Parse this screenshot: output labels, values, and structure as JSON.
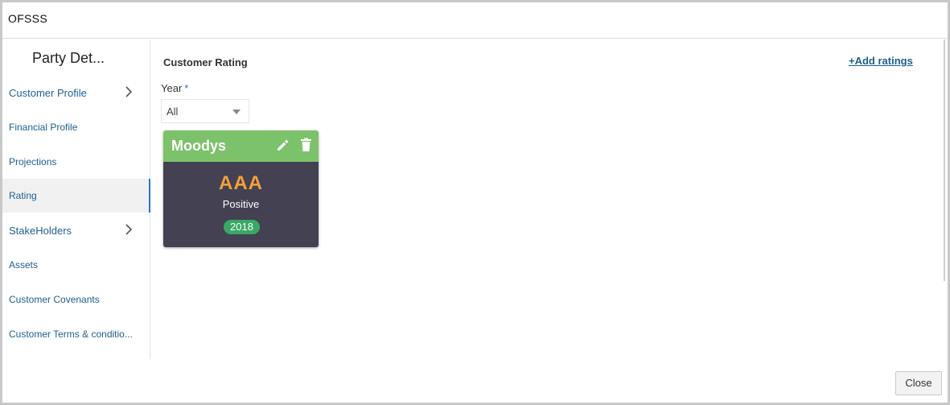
{
  "window": {
    "title": "OFSSS"
  },
  "sidebar": {
    "title": "Party Det...",
    "items": [
      {
        "label": "Customer Profile",
        "has_submenu": true
      },
      {
        "label": "Financial Profile",
        "has_submenu": false
      },
      {
        "label": "Projections",
        "has_submenu": false
      },
      {
        "label": "Rating",
        "has_submenu": false,
        "active": true
      },
      {
        "label": "StakeHolders",
        "has_submenu": true
      },
      {
        "label": "Assets",
        "has_submenu": false
      },
      {
        "label": "Customer Covenants",
        "has_submenu": false
      },
      {
        "label": "Customer Terms & conditio...",
        "has_submenu": false
      }
    ]
  },
  "main": {
    "section_title": "Customer Rating",
    "add_link": "+Add ratings",
    "year_field": {
      "label": "Year",
      "required_marker": "*",
      "value": "All"
    },
    "rating_cards": [
      {
        "agency": "Moodys",
        "grade": "AAA",
        "outlook": "Positive",
        "year": "2018",
        "edit_icon": "pencil-icon",
        "delete_icon": "trash-icon"
      }
    ]
  },
  "footer": {
    "close_label": "Close"
  },
  "colors": {
    "card_header": "#7cc26a",
    "card_body": "#434152",
    "grade": "#f4a13a",
    "year_badge": "#3aa865",
    "link": "#1d5f8f",
    "active_indicator": "#2a76c0"
  }
}
